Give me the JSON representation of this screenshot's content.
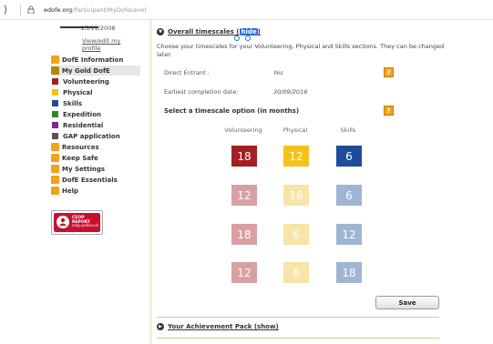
{
  "browser": {
    "url_domain": "edofe.org",
    "url_path": "/Participant/MyDofeLevel"
  },
  "sidebar": {
    "date": "25/11/2008",
    "edit_link": "View/edit my profile",
    "items": [
      {
        "label": "DofE Information",
        "color": "#f2a21b"
      },
      {
        "label": "My Gold DofE",
        "color": "#b8860b"
      },
      {
        "label": "Volunteering",
        "color": "#a31f24"
      },
      {
        "label": "Physical",
        "color": "#f2c21b"
      },
      {
        "label": "Skills",
        "color": "#1f4c9a"
      },
      {
        "label": "Expedition",
        "color": "#2a8a2a"
      },
      {
        "label": "Residential",
        "color": "#7b2d8e"
      },
      {
        "label": "GAP application",
        "color": "#555555"
      },
      {
        "label": "Resources",
        "color": "#f2a21b"
      },
      {
        "label": "Keep Safe",
        "color": "#f2a21b"
      },
      {
        "label": "My Settings",
        "color": "#f2a21b"
      },
      {
        "label": "DofE Essentials",
        "color": "#f2a21b"
      },
      {
        "label": "Help",
        "color": "#f2a21b"
      }
    ],
    "ceop": {
      "title": "CEOP REPORT",
      "sub": "ceop.police.uk"
    }
  },
  "main": {
    "section_title": "Overall timescales",
    "hide_link": "hide",
    "intro": "Choose your timescales for your Volunteering, Physical and Skills sections. They can be changed later.",
    "direct_entrant_label": "Direct Entrant :",
    "direct_entrant_value": "Yes",
    "earliest_label": "Earliest completion date:",
    "earliest_value": "30/09/2016",
    "select_label": "Select a timescale option (in months)",
    "help_icon": "?",
    "columns": [
      "Volunteering",
      "Physical",
      "Skills"
    ],
    "options": [
      {
        "values": [
          "18",
          "12",
          "6"
        ],
        "selected": true
      },
      {
        "values": [
          "12",
          "18",
          "6"
        ],
        "selected": false
      },
      {
        "values": [
          "18",
          "6",
          "12"
        ],
        "selected": false
      },
      {
        "values": [
          "12",
          "6",
          "18"
        ],
        "selected": false
      }
    ],
    "colors": {
      "vol_on": "#a31f24",
      "vol_off": "#d9a0a3",
      "phy_on": "#f7c11b",
      "phy_off": "#f8e4a6",
      "ski_on": "#1f4c9a",
      "ski_off": "#9fb5d4"
    },
    "save_label": "Save",
    "pack_title": "Your Achievement Pack (show)"
  }
}
